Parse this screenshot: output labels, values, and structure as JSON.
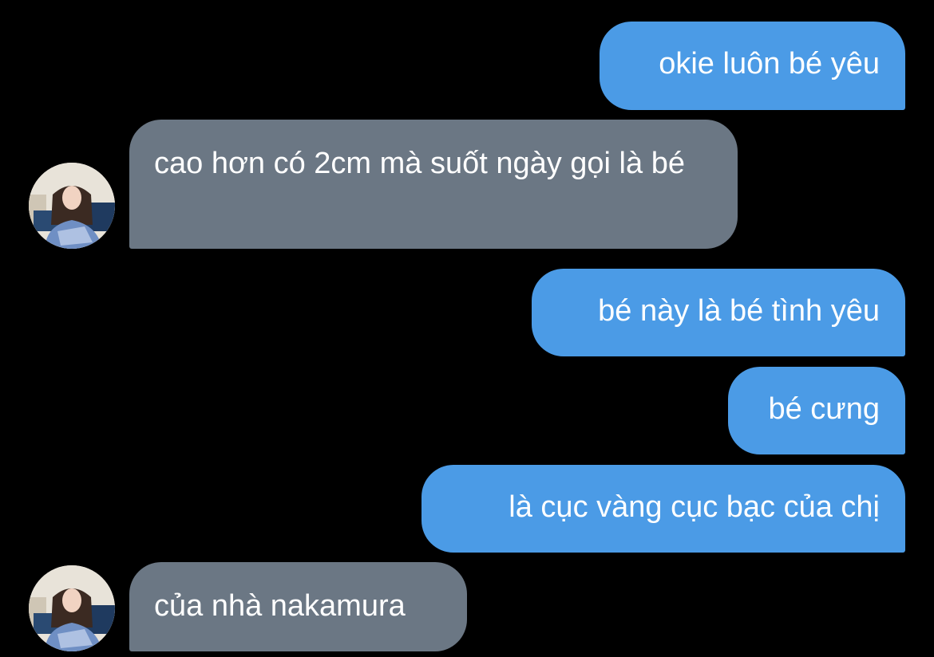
{
  "colors": {
    "background": "#000000",
    "outgoing_bubble": "#4b9be6",
    "incoming_bubble": "#6b7784",
    "text": "#ffffff"
  },
  "messages": [
    {
      "direction": "outgoing",
      "text": "okie luôn bé yêu"
    },
    {
      "direction": "incoming",
      "text": "cao hơn có 2cm mà suốt ngày gọi là bé",
      "avatar": "contact-avatar"
    },
    {
      "direction": "outgoing",
      "text": "bé này là bé tình yêu"
    },
    {
      "direction": "outgoing",
      "text": "bé cưng"
    },
    {
      "direction": "outgoing",
      "text": "là cục vàng cục bạc của chị"
    },
    {
      "direction": "incoming",
      "text": "của nhà nakamura",
      "avatar": "contact-avatar"
    }
  ]
}
